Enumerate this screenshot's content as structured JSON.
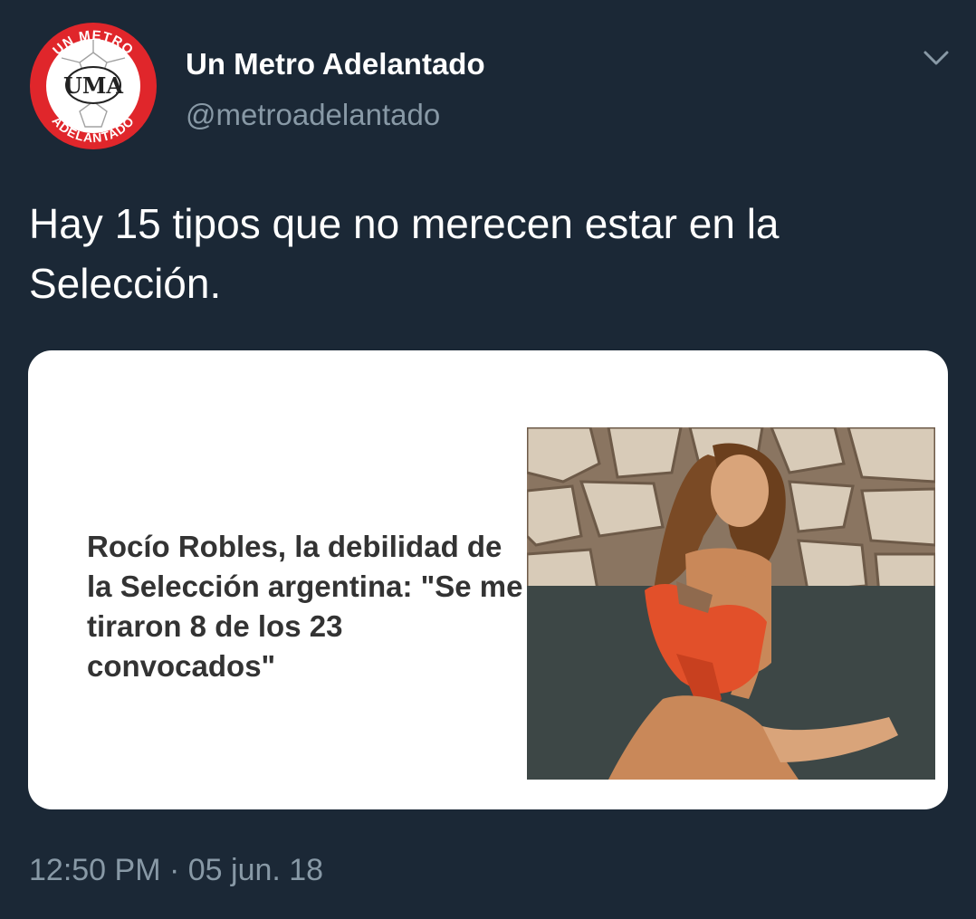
{
  "account": {
    "display_name": "Un Metro Adelantado",
    "handle": "@metroadelantado",
    "avatar": {
      "logo_text_top": "UN METRO",
      "logo_text_center": "UMA",
      "logo_text_bottom": "ADELANTADO",
      "brand_color": "#e0262b"
    }
  },
  "tweet": {
    "text": "Hay 15 tipos que no merecen estar en la Selección.",
    "timestamp": "12:50 PM · 05 jun. 18"
  },
  "card": {
    "headline": "Rocío Robles, la debilidad de la Selección argentina: \"Se me tiraron 8 de los 23 convocados\""
  },
  "icons": {
    "menu": "chevron-down-icon"
  }
}
